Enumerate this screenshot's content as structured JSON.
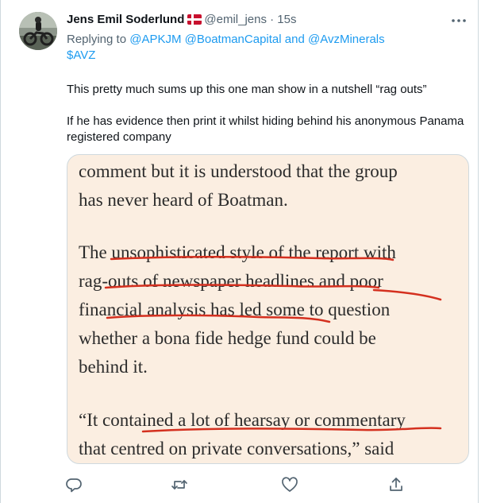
{
  "tweet": {
    "author_name": "Jens Emil Soderlund",
    "handle": "@emil_jens",
    "time": "· 15s",
    "replying_to_prefix": "Replying to",
    "mentions": [
      "@APKJM",
      "@BoatmanCapital",
      "and",
      "@AvzMinerals"
    ],
    "cashtag": "$AVZ",
    "paragraph1": "This pretty much sums up this one man show in a nutshell “rag outs”",
    "paragraph2_line1": "If he has evidence then print it whilst hiding behind his anonymous Panama",
    "paragraph2_line2": "registered company"
  },
  "clipping": {
    "lines": [
      "comment but it is understood that the group",
      "has never heard of Boatman.",
      "",
      "The unsophisticated style of the report with",
      "rag-outs of newspaper headlines and poor",
      "financial analysis has led some to question",
      "whether a bona fide hedge fund could be",
      "behind it.",
      "",
      "“It contained a lot of hearsay or commentary",
      "that centred on private conversations,” said"
    ],
    "underline_color": "#d4301f"
  },
  "icons": {
    "reply": "reply-icon",
    "retweet": "retweet-icon",
    "like": "heart-icon",
    "share": "share-icon",
    "more": "more-icon",
    "flag": "denmark-flag-icon"
  },
  "colors": {
    "link": "#1d9bf0",
    "muted": "#536471",
    "media_bg": "#fbeee1"
  }
}
